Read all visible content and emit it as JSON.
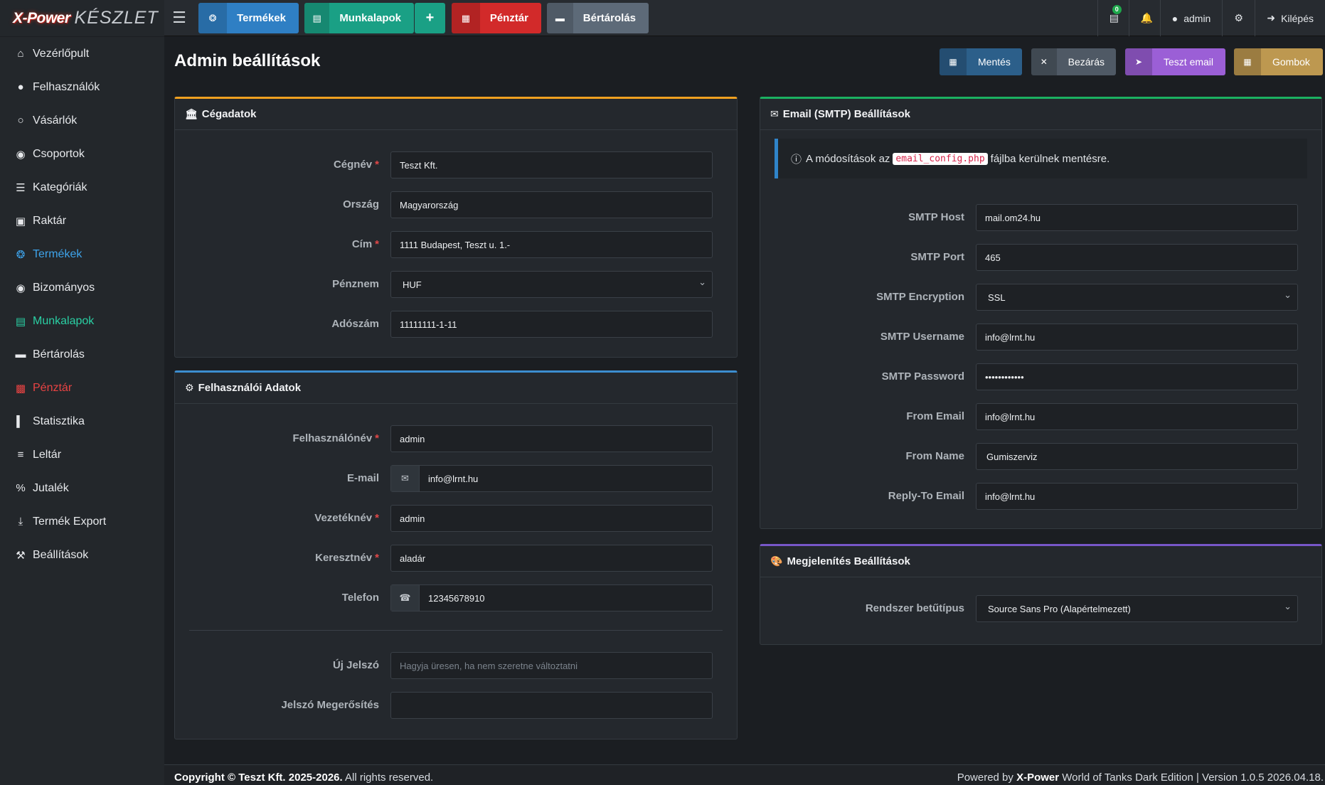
{
  "brand": {
    "logo": "X-Power",
    "name": "KÉSZLET"
  },
  "topnav": {
    "termekek": "Termékek",
    "munkalapok": "Munkalapok",
    "plus": "+",
    "penztar": "Pénztár",
    "bertarolas": "Bértárolás"
  },
  "topright": {
    "badge": "0",
    "user": "admin",
    "logout": "Kilépés"
  },
  "sidebar": {
    "items": [
      {
        "label": "Vezérlőpult",
        "icon": "home-icon"
      },
      {
        "label": "Felhasználók",
        "icon": "user-icon"
      },
      {
        "label": "Vásárlók",
        "icon": "user-outline-icon"
      },
      {
        "label": "Csoportok",
        "icon": "users-icon"
      },
      {
        "label": "Kategóriák",
        "icon": "layers-icon"
      },
      {
        "label": "Raktár",
        "icon": "warehouse-icon"
      },
      {
        "label": "Termékek",
        "icon": "tire-icon"
      },
      {
        "label": "Bizományos",
        "icon": "user-circle-icon"
      },
      {
        "label": "Munkalapok",
        "icon": "file-icon"
      },
      {
        "label": "Bértárolás",
        "icon": "archive-icon"
      },
      {
        "label": "Pénztár",
        "icon": "money-icon"
      },
      {
        "label": "Statisztika",
        "icon": "chart-icon"
      },
      {
        "label": "Leltár",
        "icon": "list-icon"
      },
      {
        "label": "Jutalék",
        "icon": "percent-icon"
      },
      {
        "label": "Termék Export",
        "icon": "download-icon"
      },
      {
        "label": "Beállítások",
        "icon": "wrench-icon"
      }
    ]
  },
  "page": {
    "title": "Admin beállítások"
  },
  "actions": {
    "save": "Mentés",
    "close": "Bezárás",
    "test_email": "Teszt email",
    "buttons": "Gombok"
  },
  "company": {
    "title": "Cégadatok",
    "fields": {
      "name_label": "Cégnév",
      "name": "Teszt Kft.",
      "country_label": "Ország",
      "country": "Magyarország",
      "address_label": "Cím",
      "address": "1111 Budapest, Teszt u. 1.-",
      "currency_label": "Pénznem",
      "currency": "HUF",
      "tax_label": "Adószám",
      "tax": "11111111-1-11"
    }
  },
  "user": {
    "title": "Felhasználói Adatok",
    "fields": {
      "username_label": "Felhasználónév",
      "username": "admin",
      "email_label": "E-mail",
      "email": "info@lrnt.hu",
      "lastname_label": "Vezetéknév",
      "lastname": "admin",
      "firstname_label": "Keresztnév",
      "firstname": "aladár",
      "phone_label": "Telefon",
      "phone": "12345678910",
      "newpass_label": "Új Jelszó",
      "newpass_placeholder": "Hagyja üresen, ha nem szeretne változtatni",
      "confirm_label": "Jelszó Megerősítés"
    }
  },
  "smtp": {
    "title": "Email (SMTP) Beállítások",
    "info_pre": "A módosítások az",
    "info_code": "email_config.php",
    "info_post": "fájlba kerülnek mentésre.",
    "fields": {
      "host_label": "SMTP Host",
      "host": "mail.om24.hu",
      "port_label": "SMTP Port",
      "port": "465",
      "enc_label": "SMTP Encryption",
      "enc": "SSL",
      "user_label": "SMTP Username",
      "user": "info@lrnt.hu",
      "pass_label": "SMTP Password",
      "pass": "••••••••••••",
      "from_label": "From Email",
      "from": "info@lrnt.hu",
      "fromname_label": "From Name",
      "fromname": "Gumiszerviz",
      "reply_label": "Reply-To Email",
      "reply": "info@lrnt.hu"
    }
  },
  "appearance": {
    "title": "Megjelenítés Beállítások",
    "font_label": "Rendszer betűtípus",
    "font": "Source Sans Pro (Alapértelmezett)"
  },
  "footer": {
    "copyright": "Copyright © Teszt Kft. 2025-2026.",
    "rights": "All rights reserved.",
    "powered_pre": "Powered by",
    "powered_brand": "X-Power",
    "powered_post": "World of Tanks Dark Edition | Version 1.0.5 2026.04.18."
  }
}
